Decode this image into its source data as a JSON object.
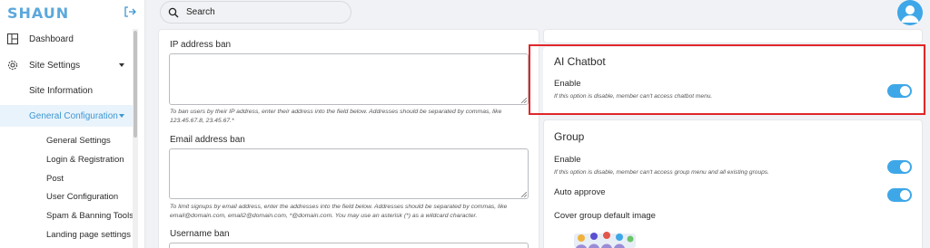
{
  "app": {
    "logo_text": "SHAUN"
  },
  "search": {
    "placeholder": "Search"
  },
  "sidebar": {
    "dashboard": "Dashboard",
    "site_settings": "Site Settings",
    "site_information": "Site Information",
    "general_configuration": "General Configuration",
    "sub_items": [
      "General Settings",
      "Login & Registration",
      "Post",
      "User Configuration",
      "Spam & Banning Tools",
      "Landing page settings"
    ]
  },
  "form": {
    "ip_ban_label": "IP address ban",
    "ip_ban_value": "",
    "ip_ban_hint": "To ban users by their IP address, enter their address into the field below. Addresses should be separated by commas, like 123.45.67.8, 23.45.67.*",
    "email_ban_label": "Email address ban",
    "email_ban_value": "",
    "email_ban_hint": "To limit signups by email address, enter the addresses into the field below. Addresses should be separated by commas, like email@domain.com, email2@domain.com, *@domain.com. You may use an asterisk (*) as a wildcard character.",
    "username_ban_label": "Username ban"
  },
  "ai_chatbot": {
    "title": "AI Chatbot",
    "enable_label": "Enable",
    "enable_hint": "If this option is disable, member can't access chatbot menu.",
    "enabled": true
  },
  "group": {
    "title": "Group",
    "enable_label": "Enable",
    "enable_hint": "If this option is disable, member can't access group menu and all existing groups.",
    "enabled": true,
    "auto_approve_label": "Auto approve",
    "auto_approve": true,
    "cover_label": "Cover group default image"
  },
  "colors": {
    "accent": "#3ea7e8",
    "highlight": "#e0262a"
  }
}
